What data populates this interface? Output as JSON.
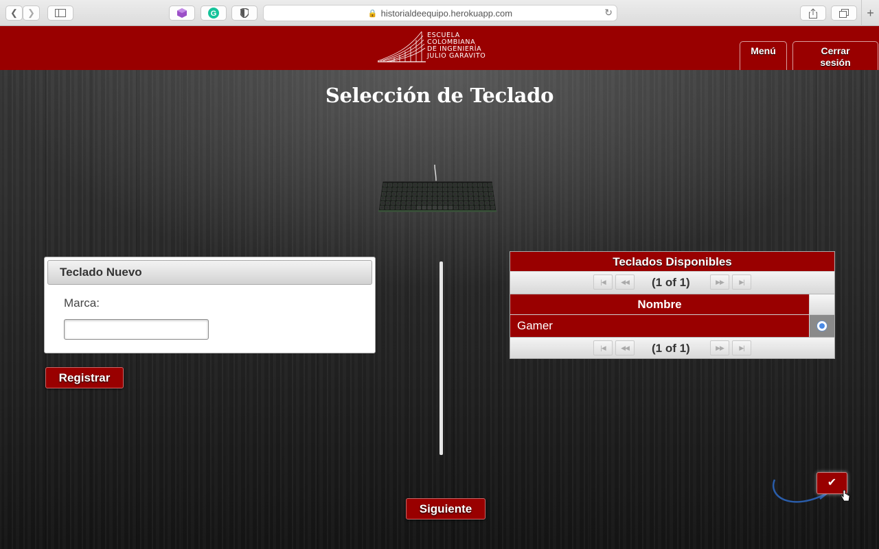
{
  "browser": {
    "url": "historialdeequipo.herokuapp.com",
    "icons": [
      "back-icon",
      "forward-icon",
      "sidebar-icon",
      "extension-cube-icon",
      "grammarly-icon",
      "shield-icon",
      "lock-icon",
      "reload-icon",
      "share-icon",
      "tabs-icon",
      "new-tab-icon"
    ]
  },
  "header": {
    "logo_lines": [
      "Escuela",
      "Colombiana",
      "de Ingeniería",
      "Julio Garavito"
    ],
    "menu_label": "Menú",
    "logout_line1": "Cerrar",
    "logout_line2": "sesión"
  },
  "page": {
    "title": "Selección de Teclado"
  },
  "form": {
    "panel_title": "Teclado Nuevo",
    "brand_label": "Marca:",
    "brand_value": "",
    "register_label": "Registrar"
  },
  "table": {
    "caption": "Teclados Disponibles",
    "page_report": "(1 of 1)",
    "column_header": "Nombre",
    "rows": [
      {
        "name": "Gamer",
        "selected": true
      }
    ]
  },
  "actions": {
    "next_label": "Siguiente",
    "confirm_icon": "check-icon"
  },
  "colors": {
    "brand_red": "#990000"
  }
}
